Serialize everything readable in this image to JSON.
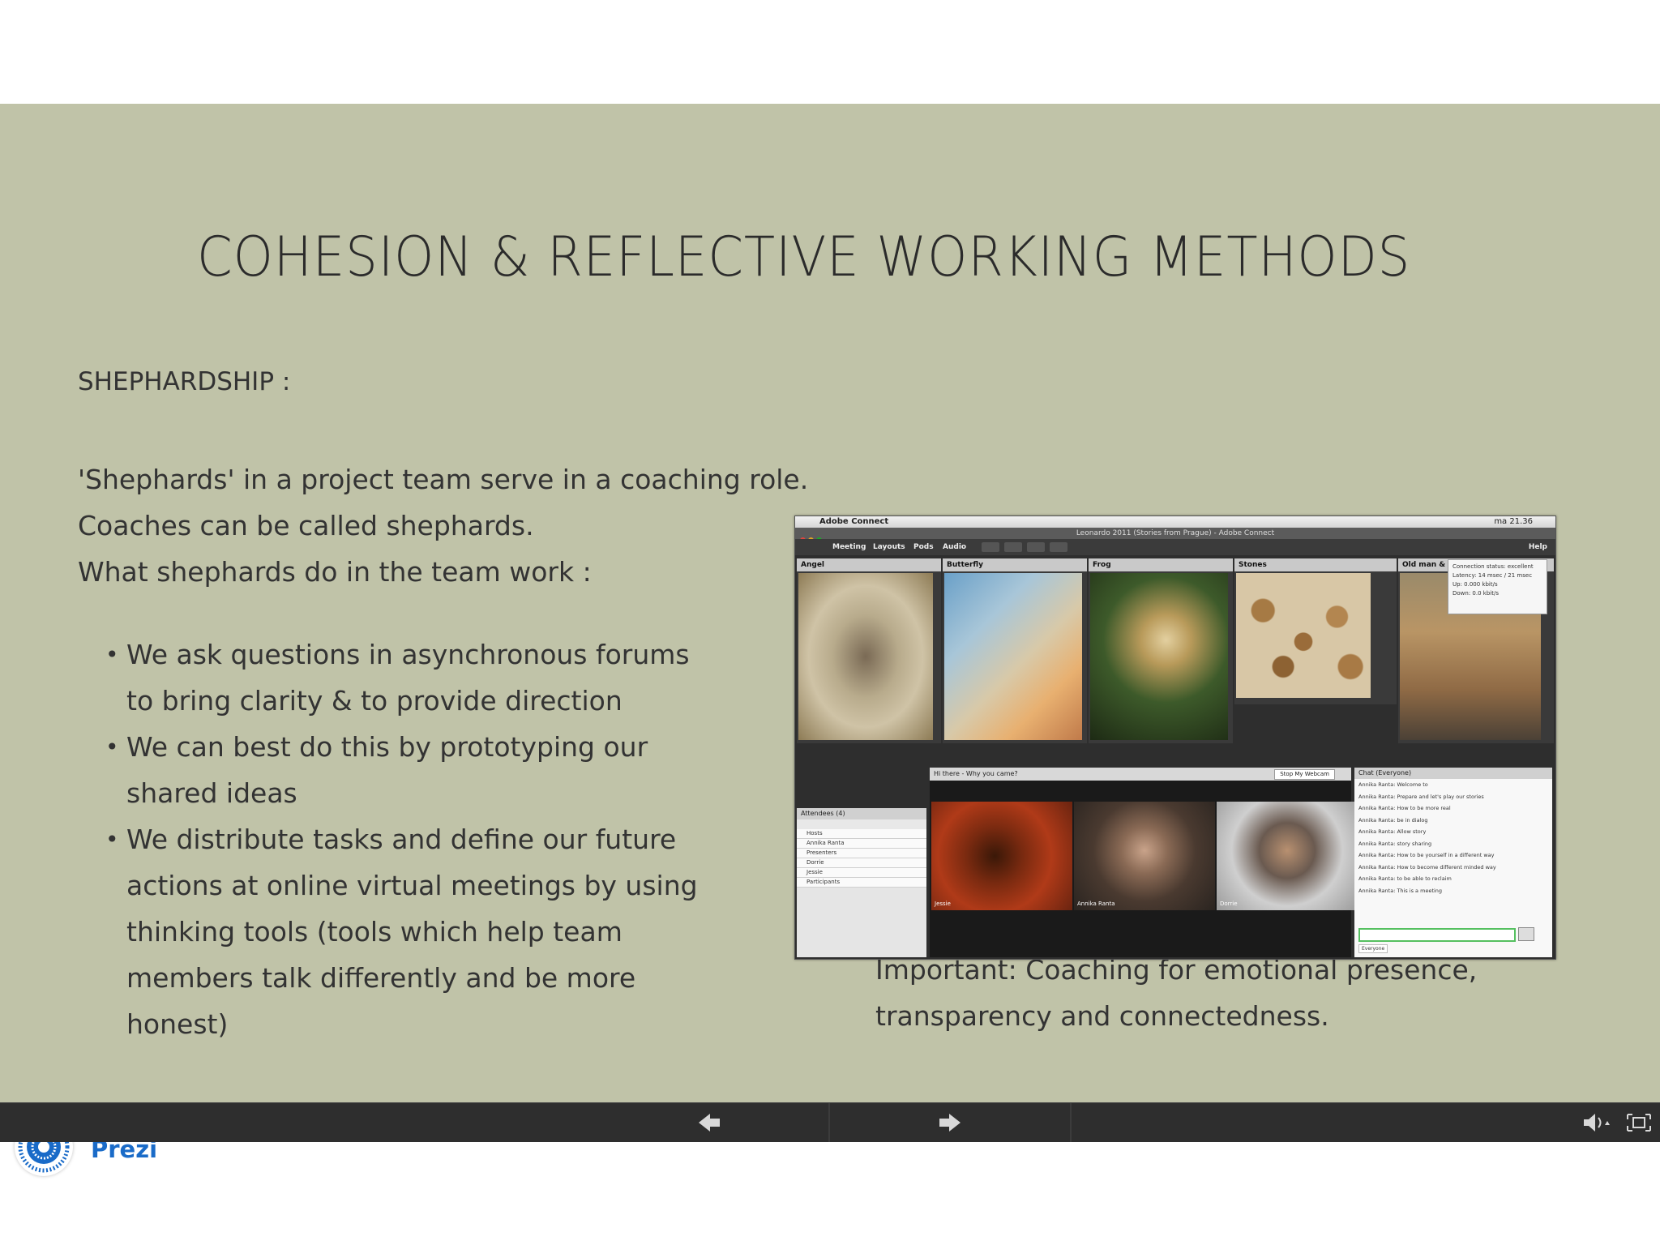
{
  "slide": {
    "title": "COHESION & REFLECTIVE WORKING METHODS",
    "subtitle": "SHEPHARDSHIP :",
    "paragraphs": [
      "'Shephards' in a project team serve in a coaching role.",
      "Coaches can be called shephards.",
      "What shephards do in the team work :"
    ],
    "bullets": [
      "We ask questions in asynchronous forums to bring clarity & to provide direction",
      "We can best do this by prototyping our shared ideas",
      "We distribute tasks and define our future actions at online virtual meetings by using thinking tools (tools which help team members talk differently and be more honest)"
    ],
    "important": "Important: Coaching for emotional presence, transparency and connectedness.",
    "background_color": "#c0c3a8"
  },
  "screenshot": {
    "os_app_name": "Adobe Connect",
    "clock": "ma 21.36",
    "window_title": "Leonardo 2011 (Stories from Prague) - Adobe Connect",
    "menu": [
      "Meeting",
      "Layouts",
      "Pods",
      "Audio"
    ],
    "help": "Help",
    "pods": [
      {
        "title": "Angel",
        "mood": "angel"
      },
      {
        "title": "Butterfly",
        "mood": "butterfly"
      },
      {
        "title": "Frog",
        "mood": "frog"
      },
      {
        "title": "Stones",
        "mood": "stones"
      },
      {
        "title": "Old man &",
        "mood": "city"
      }
    ],
    "connection_tooltip": [
      "Connection status: excellent",
      "Latency: 14 msec / 21 msec",
      "Up: 0.000 kbit/s",
      "Down: 0.0 kbit/s"
    ],
    "attendees": {
      "title": "Attendees (4)",
      "rows": [
        "Hosts",
        "Annika Ranta",
        "Presenters",
        "Dorrie",
        "Jessie",
        "Participants"
      ]
    },
    "video": {
      "title": "Hi there - Why you came?",
      "button": "Stop My Webcam",
      "names": [
        "Jessie",
        "Annika Ranta",
        "Dorrie"
      ]
    },
    "chat": {
      "title": "Chat (Everyone)",
      "lines": [
        "Annika Ranta: Welcome to",
        "Annika Ranta: Prepare and let's play our stories",
        "Annika Ranta: How to be more real",
        "Annika Ranta: be in dialog",
        "Annika Ranta: Allow story",
        "Annika Ranta: story sharing",
        "Annika Ranta: How to be yourself in a different way",
        "Annika Ranta: How to become different minded way",
        "Annika Ranta: to be able to reclaim",
        "Annika Ranta: This is a meeting"
      ],
      "status": "Everyone"
    }
  },
  "logo": {
    "text": "Prezi"
  },
  "navbar": {
    "prev": "Previous step",
    "next": "Next step"
  },
  "colors": {
    "accent_blue": "#1a6bc8",
    "navbar": "#2e2e2e",
    "chat_input_border": "#55c060"
  }
}
